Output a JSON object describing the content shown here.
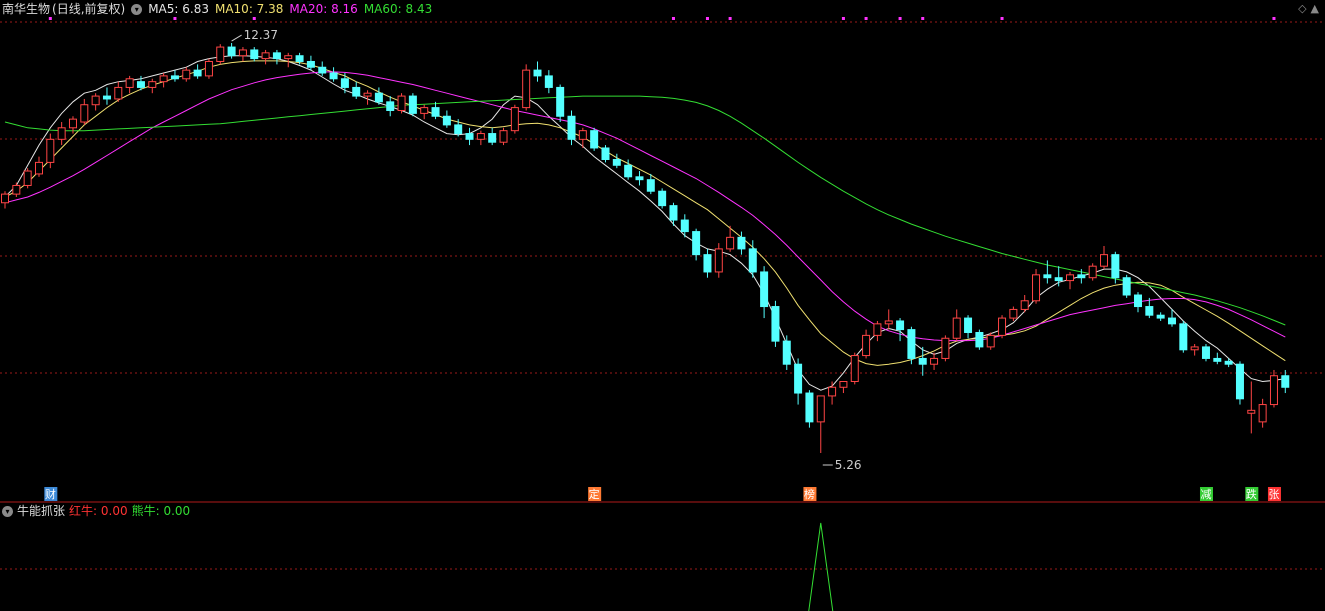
{
  "header": {
    "stock_name": "南华生物",
    "period": "(日线,前复权)",
    "ma": [
      {
        "label": "MA5: 6.83",
        "color": "#e6e6e6"
      },
      {
        "label": "MA10: 7.38",
        "color": "#f0e070"
      },
      {
        "label": "MA20: 8.16",
        "color": "#ff33ff"
      },
      {
        "label": "MA60: 8.43",
        "color": "#33dd33"
      }
    ]
  },
  "indicator": {
    "name": "牛能抓张",
    "values": [
      {
        "label": "红牛: 0.00",
        "color": "#ff3333"
      },
      {
        "label": "熊牛: 0.00",
        "color": "#33dd33"
      }
    ]
  },
  "controls": {
    "diamond": "◇",
    "up": "▲"
  },
  "colors": {
    "up": "#ff4545",
    "down": "#54ffff",
    "grid": "#9a1a1a",
    "sep": "#b01a1a"
  },
  "chart_data": {
    "type": "candlestick",
    "y_range": [
      5.0,
      12.7
    ],
    "annotations": [
      {
        "text": "12.37",
        "index": 20,
        "value": 12.37
      },
      {
        "text": "5.26",
        "index": 72,
        "value": 5.26
      }
    ],
    "event_markers": [
      {
        "text": "财",
        "index": 4,
        "color": "#3d8ad8"
      },
      {
        "text": "定",
        "index": 52,
        "color": "#ff7a33"
      },
      {
        "text": "榜",
        "index": 71,
        "color": "#ff7a33"
      },
      {
        "text": "减",
        "index": 106,
        "color": "#33cc33"
      },
      {
        "text": "跌",
        "index": 110,
        "color": "#33cc33"
      },
      {
        "text": "张",
        "index": 112,
        "color": "#ff3333"
      }
    ],
    "top_dots": [
      4,
      15,
      22,
      59,
      62,
      64,
      74,
      76,
      79,
      81,
      88,
      112
    ],
    "candles": [
      [
        9.6,
        9.8,
        9.5,
        9.75
      ],
      [
        9.75,
        9.95,
        9.7,
        9.9
      ],
      [
        9.9,
        10.2,
        9.85,
        10.15
      ],
      [
        10.1,
        10.4,
        10.05,
        10.3
      ],
      [
        10.3,
        10.8,
        10.2,
        10.7
      ],
      [
        10.7,
        11.0,
        10.6,
        10.9
      ],
      [
        10.9,
        11.1,
        10.8,
        11.05
      ],
      [
        11.0,
        11.4,
        10.95,
        11.3
      ],
      [
        11.3,
        11.5,
        11.2,
        11.45
      ],
      [
        11.45,
        11.6,
        11.3,
        11.4
      ],
      [
        11.4,
        11.7,
        11.35,
        11.6
      ],
      [
        11.6,
        11.8,
        11.5,
        11.75
      ],
      [
        11.7,
        11.8,
        11.55,
        11.6
      ],
      [
        11.6,
        11.75,
        11.5,
        11.7
      ],
      [
        11.7,
        11.85,
        11.6,
        11.8
      ],
      [
        11.8,
        11.9,
        11.7,
        11.75
      ],
      [
        11.75,
        11.95,
        11.7,
        11.9
      ],
      [
        11.9,
        12.0,
        11.75,
        11.8
      ],
      [
        11.8,
        12.1,
        11.75,
        12.05
      ],
      [
        12.05,
        12.35,
        12.0,
        12.3
      ],
      [
        12.3,
        12.37,
        12.1,
        12.15
      ],
      [
        12.15,
        12.3,
        12.05,
        12.25
      ],
      [
        12.25,
        12.3,
        12.05,
        12.1
      ],
      [
        12.1,
        12.25,
        12.0,
        12.2
      ],
      [
        12.2,
        12.25,
        12.0,
        12.1
      ],
      [
        12.1,
        12.2,
        11.95,
        12.15
      ],
      [
        12.15,
        12.2,
        12.0,
        12.05
      ],
      [
        12.05,
        12.15,
        11.9,
        11.95
      ],
      [
        11.95,
        12.05,
        11.8,
        11.85
      ],
      [
        11.85,
        11.95,
        11.7,
        11.75
      ],
      [
        11.75,
        11.85,
        11.5,
        11.6
      ],
      [
        11.6,
        11.7,
        11.4,
        11.45
      ],
      [
        11.45,
        11.55,
        11.3,
        11.5
      ],
      [
        11.5,
        11.6,
        11.3,
        11.35
      ],
      [
        11.35,
        11.45,
        11.1,
        11.2
      ],
      [
        11.2,
        11.5,
        11.15,
        11.45
      ],
      [
        11.45,
        11.5,
        11.1,
        11.15
      ],
      [
        11.15,
        11.3,
        11.05,
        11.25
      ],
      [
        11.25,
        11.35,
        11.05,
        11.1
      ],
      [
        11.1,
        11.2,
        10.9,
        10.95
      ],
      [
        10.95,
        11.05,
        10.75,
        10.8
      ],
      [
        10.8,
        10.9,
        10.6,
        10.7
      ],
      [
        10.7,
        10.85,
        10.6,
        10.8
      ],
      [
        10.8,
        10.9,
        10.6,
        10.65
      ],
      [
        10.65,
        10.9,
        10.6,
        10.85
      ],
      [
        10.85,
        11.3,
        10.8,
        11.25
      ],
      [
        11.25,
        12.0,
        11.2,
        11.9
      ],
      [
        11.9,
        12.05,
        11.7,
        11.8
      ],
      [
        11.8,
        11.9,
        11.5,
        11.6
      ],
      [
        11.6,
        11.65,
        11.0,
        11.1
      ],
      [
        11.1,
        11.2,
        10.6,
        10.7
      ],
      [
        10.7,
        10.9,
        10.55,
        10.85
      ],
      [
        10.85,
        10.9,
        10.5,
        10.55
      ],
      [
        10.55,
        10.6,
        10.3,
        10.35
      ],
      [
        10.35,
        10.45,
        10.2,
        10.25
      ],
      [
        10.25,
        10.35,
        10.0,
        10.05
      ],
      [
        10.05,
        10.15,
        9.9,
        10.0
      ],
      [
        10.0,
        10.1,
        9.75,
        9.8
      ],
      [
        9.8,
        9.85,
        9.5,
        9.55
      ],
      [
        9.55,
        9.6,
        9.2,
        9.3
      ],
      [
        9.3,
        9.4,
        9.0,
        9.1
      ],
      [
        9.1,
        9.15,
        8.6,
        8.7
      ],
      [
        8.7,
        8.8,
        8.3,
        8.4
      ],
      [
        8.4,
        8.9,
        8.3,
        8.8
      ],
      [
        8.8,
        9.2,
        8.75,
        9.0
      ],
      [
        9.0,
        9.1,
        8.7,
        8.8
      ],
      [
        8.8,
        8.95,
        8.3,
        8.4
      ],
      [
        8.4,
        8.5,
        7.6,
        7.8
      ],
      [
        7.8,
        7.9,
        7.1,
        7.2
      ],
      [
        7.2,
        7.3,
        6.7,
        6.8
      ],
      [
        6.8,
        6.9,
        6.1,
        6.3
      ],
      [
        6.3,
        6.35,
        5.7,
        5.8
      ],
      [
        5.8,
        6.2,
        5.26,
        6.25
      ],
      [
        6.25,
        6.5,
        6.1,
        6.4
      ],
      [
        6.4,
        6.5,
        6.3,
        6.5
      ],
      [
        6.5,
        7.0,
        6.45,
        6.95
      ],
      [
        6.95,
        7.4,
        6.9,
        7.3
      ],
      [
        7.3,
        7.55,
        7.2,
        7.5
      ],
      [
        7.5,
        7.75,
        7.4,
        7.55
      ],
      [
        7.55,
        7.6,
        7.2,
        7.4
      ],
      [
        7.4,
        7.45,
        6.8,
        6.9
      ],
      [
        6.9,
        7.1,
        6.6,
        6.8
      ],
      [
        6.8,
        7.0,
        6.7,
        6.9
      ],
      [
        6.9,
        7.3,
        6.85,
        7.25
      ],
      [
        7.25,
        7.75,
        7.2,
        7.6
      ],
      [
        7.6,
        7.65,
        7.25,
        7.35
      ],
      [
        7.35,
        7.4,
        7.05,
        7.1
      ],
      [
        7.1,
        7.35,
        7.05,
        7.3
      ],
      [
        7.3,
        7.65,
        7.25,
        7.6
      ],
      [
        7.6,
        7.8,
        7.55,
        7.75
      ],
      [
        7.75,
        8.0,
        7.7,
        7.9
      ],
      [
        7.9,
        8.45,
        7.85,
        8.35
      ],
      [
        8.35,
        8.6,
        8.2,
        8.3
      ],
      [
        8.3,
        8.5,
        8.15,
        8.25
      ],
      [
        8.25,
        8.4,
        8.1,
        8.35
      ],
      [
        8.35,
        8.45,
        8.2,
        8.3
      ],
      [
        8.3,
        8.55,
        8.25,
        8.5
      ],
      [
        8.5,
        8.85,
        8.45,
        8.7
      ],
      [
        8.7,
        8.75,
        8.2,
        8.3
      ],
      [
        8.3,
        8.35,
        7.95,
        8.0
      ],
      [
        8.0,
        8.05,
        7.7,
        7.8
      ],
      [
        7.8,
        7.95,
        7.6,
        7.65
      ],
      [
        7.65,
        7.7,
        7.55,
        7.6
      ],
      [
        7.6,
        7.75,
        7.45,
        7.5
      ],
      [
        7.5,
        7.55,
        7.0,
        7.05
      ],
      [
        7.05,
        7.15,
        6.95,
        7.1
      ],
      [
        7.1,
        7.15,
        6.85,
        6.9
      ],
      [
        6.9,
        7.0,
        6.8,
        6.85
      ],
      [
        6.85,
        6.9,
        6.75,
        6.8
      ],
      [
        6.8,
        6.85,
        6.1,
        6.2
      ],
      [
        5.95,
        6.5,
        5.6,
        6.0
      ],
      [
        5.8,
        6.2,
        5.7,
        6.1
      ],
      [
        6.1,
        6.7,
        6.05,
        6.6
      ],
      [
        6.6,
        6.7,
        6.3,
        6.4
      ]
    ],
    "ma_series": [
      {
        "name": "MA5",
        "color": "#e6e6e6",
        "values": [
          9.7,
          9.9,
          10.25,
          10.6,
          10.9,
          11.15,
          11.35,
          11.5,
          11.55,
          11.65,
          11.7,
          11.72,
          11.75,
          11.8,
          11.85,
          11.9,
          11.95,
          12.05,
          12.1,
          12.13,
          12.15,
          12.15,
          12.14,
          12.12,
          12.1,
          12.05,
          11.98,
          11.9,
          11.78,
          11.66,
          11.55,
          11.48,
          11.4,
          11.33,
          11.27,
          11.2,
          11.12,
          11.0,
          10.9,
          10.8,
          10.78,
          10.8,
          10.9,
          11.05,
          11.3,
          11.45,
          11.42,
          11.3,
          11.1,
          10.92,
          10.73,
          10.58,
          10.4,
          10.25,
          10.1,
          9.95,
          9.8,
          9.63,
          9.45,
          9.23,
          9.03,
          8.9,
          8.8,
          8.76,
          8.7,
          8.55,
          8.35,
          8.02,
          7.6,
          7.15,
          6.7,
          6.45,
          6.35,
          6.42,
          6.65,
          6.92,
          7.15,
          7.35,
          7.42,
          7.37,
          7.2,
          7.05,
          6.97,
          7.03,
          7.16,
          7.23,
          7.27,
          7.33,
          7.4,
          7.52,
          7.72,
          7.95,
          8.1,
          8.22,
          8.27,
          8.33,
          8.38,
          8.45,
          8.45,
          8.4,
          8.3,
          8.15,
          7.95,
          7.75,
          7.55,
          7.37,
          7.21,
          7.08,
          6.9,
          6.72,
          6.55,
          6.5,
          6.52,
          6.55
        ]
      },
      {
        "name": "MA10",
        "color": "#f0e070",
        "values": [
          9.7,
          9.8,
          9.95,
          10.15,
          10.35,
          10.55,
          10.75,
          10.95,
          11.1,
          11.25,
          11.38,
          11.48,
          11.57,
          11.64,
          11.7,
          11.76,
          11.82,
          11.88,
          11.95,
          12.0,
          12.03,
          12.05,
          12.06,
          12.06,
          12.06,
          12.05,
          12.03,
          11.99,
          11.93,
          11.86,
          11.8,
          11.7,
          11.62,
          11.52,
          11.43,
          11.35,
          11.28,
          11.2,
          11.13,
          11.05,
          11.0,
          10.95,
          10.92,
          10.9,
          10.92,
          10.95,
          10.97,
          10.98,
          10.95,
          10.9,
          10.82,
          10.74,
          10.62,
          10.5,
          10.38,
          10.28,
          10.18,
          10.08,
          9.96,
          9.84,
          9.72,
          9.6,
          9.48,
          9.32,
          9.16,
          9.0,
          8.83,
          8.63,
          8.4,
          8.12,
          7.82,
          7.57,
          7.33,
          7.17,
          7.01,
          6.89,
          6.81,
          6.78,
          6.8,
          6.83,
          6.88,
          6.95,
          7.03,
          7.13,
          7.2,
          7.23,
          7.25,
          7.28,
          7.3,
          7.33,
          7.38,
          7.46,
          7.58,
          7.7,
          7.82,
          7.94,
          8.04,
          8.12,
          8.17,
          8.2,
          8.22,
          8.21,
          8.17,
          8.08,
          7.96,
          7.85,
          7.74,
          7.63,
          7.51,
          7.38,
          7.25,
          7.12,
          6.99,
          6.86
        ]
      },
      {
        "name": "MA20",
        "color": "#ff33ff",
        "values": [
          9.6,
          9.65,
          9.7,
          9.78,
          9.87,
          9.97,
          10.07,
          10.18,
          10.3,
          10.42,
          10.54,
          10.66,
          10.78,
          10.9,
          11.0,
          11.1,
          11.2,
          11.3,
          11.4,
          11.48,
          11.56,
          11.62,
          11.68,
          11.73,
          11.77,
          11.8,
          11.83,
          11.85,
          11.87,
          11.87,
          11.86,
          11.84,
          11.81,
          11.77,
          11.73,
          11.69,
          11.65,
          11.6,
          11.55,
          11.5,
          11.45,
          11.4,
          11.35,
          11.3,
          11.25,
          11.2,
          11.16,
          11.12,
          11.08,
          11.04,
          11.0,
          10.95,
          10.88,
          10.8,
          10.72,
          10.62,
          10.52,
          10.42,
          10.32,
          10.22,
          10.12,
          10.02,
          9.9,
          9.78,
          9.65,
          9.52,
          9.38,
          9.22,
          9.05,
          8.86,
          8.66,
          8.46,
          8.26,
          8.06,
          7.88,
          7.72,
          7.58,
          7.46,
          7.38,
          7.32,
          7.27,
          7.24,
          7.22,
          7.21,
          7.21,
          7.21,
          7.22,
          7.25,
          7.3,
          7.36,
          7.42,
          7.48,
          7.54,
          7.6,
          7.66,
          7.7,
          7.74,
          7.78,
          7.82,
          7.85,
          7.88,
          7.91,
          7.93,
          7.94,
          7.94,
          7.92,
          7.88,
          7.82,
          7.75,
          7.66,
          7.57,
          7.47,
          7.37,
          7.27
        ]
      },
      {
        "name": "MA60",
        "color": "#33dd33",
        "values": [
          11.0,
          10.95,
          10.9,
          10.88,
          10.86,
          10.85,
          10.85,
          10.85,
          10.86,
          10.87,
          10.88,
          10.89,
          10.9,
          10.91,
          10.92,
          10.93,
          10.94,
          10.95,
          10.96,
          10.97,
          10.99,
          11.01,
          11.03,
          11.05,
          11.07,
          11.09,
          11.11,
          11.13,
          11.15,
          11.17,
          11.19,
          11.21,
          11.23,
          11.25,
          11.27,
          11.29,
          11.3,
          11.31,
          11.32,
          11.33,
          11.34,
          11.35,
          11.36,
          11.37,
          11.38,
          11.39,
          11.4,
          11.41,
          11.42,
          11.43,
          11.44,
          11.45,
          11.45,
          11.45,
          11.45,
          11.45,
          11.45,
          11.44,
          11.43,
          11.41,
          11.38,
          11.34,
          11.28,
          11.2,
          11.1,
          10.98,
          10.85,
          10.72,
          10.58,
          10.44,
          10.3,
          10.17,
          10.04,
          9.92,
          9.8,
          9.69,
          9.58,
          9.48,
          9.39,
          9.31,
          9.23,
          9.16,
          9.09,
          9.02,
          8.96,
          8.9,
          8.84,
          8.78,
          8.72,
          8.67,
          8.62,
          8.57,
          8.52,
          8.48,
          8.44,
          8.4,
          8.36,
          8.32,
          8.28,
          8.24,
          8.2,
          8.16,
          8.12,
          8.08,
          8.04,
          8.0,
          7.95,
          7.9,
          7.84,
          7.78,
          7.71,
          7.64,
          7.56,
          7.48
        ]
      }
    ],
    "indicator_series": {
      "name": "熊牛",
      "color": "#33dd33",
      "spike_index": 72,
      "values": [
        0,
        1
      ]
    }
  }
}
